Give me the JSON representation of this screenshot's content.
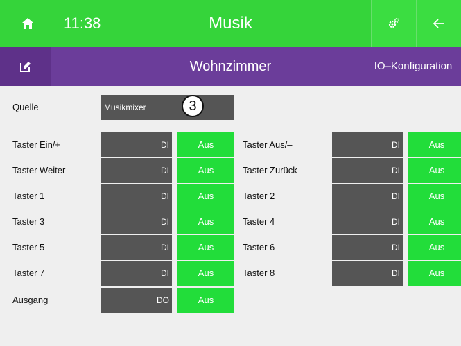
{
  "header": {
    "time": "11:38",
    "title": "Musik",
    "home_icon": "home-icon",
    "settings_icon": "gear-icon",
    "back_icon": "arrow-left-icon"
  },
  "subheader": {
    "room": "Wohnzimmer",
    "io_config": "IO–Konfiguration",
    "edit_icon": "edit-icon"
  },
  "source": {
    "label": "Quelle",
    "value": "Musikmixer",
    "badge": "3"
  },
  "left_rows": [
    {
      "label": "Taster Ein/+",
      "type": "DI",
      "state": "Aus"
    },
    {
      "label": "Taster Weiter",
      "type": "DI",
      "state": "Aus"
    },
    {
      "label": "Taster 1",
      "type": "DI",
      "state": "Aus"
    },
    {
      "label": "Taster 3",
      "type": "DI",
      "state": "Aus"
    },
    {
      "label": "Taster 5",
      "type": "DI",
      "state": "Aus"
    },
    {
      "label": "Taster 7",
      "type": "DI",
      "state": "Aus"
    },
    {
      "label": "Ausgang",
      "type": "DO",
      "state": "Aus"
    }
  ],
  "right_rows": [
    {
      "label": "Taster Aus/–",
      "type": "DI",
      "state": "Aus"
    },
    {
      "label": "Taster Zurück",
      "type": "DI",
      "state": "Aus"
    },
    {
      "label": "Taster 2",
      "type": "DI",
      "state": "Aus"
    },
    {
      "label": "Taster 4",
      "type": "DI",
      "state": "Aus"
    },
    {
      "label": "Taster 6",
      "type": "DI",
      "state": "Aus"
    },
    {
      "label": "Taster 8",
      "type": "DI",
      "state": "Aus"
    }
  ],
  "colors": {
    "header_green": "#35d43a",
    "subheader_purple": "#6b3d9a",
    "field_gray": "#555555",
    "state_green": "#22dd3a"
  }
}
